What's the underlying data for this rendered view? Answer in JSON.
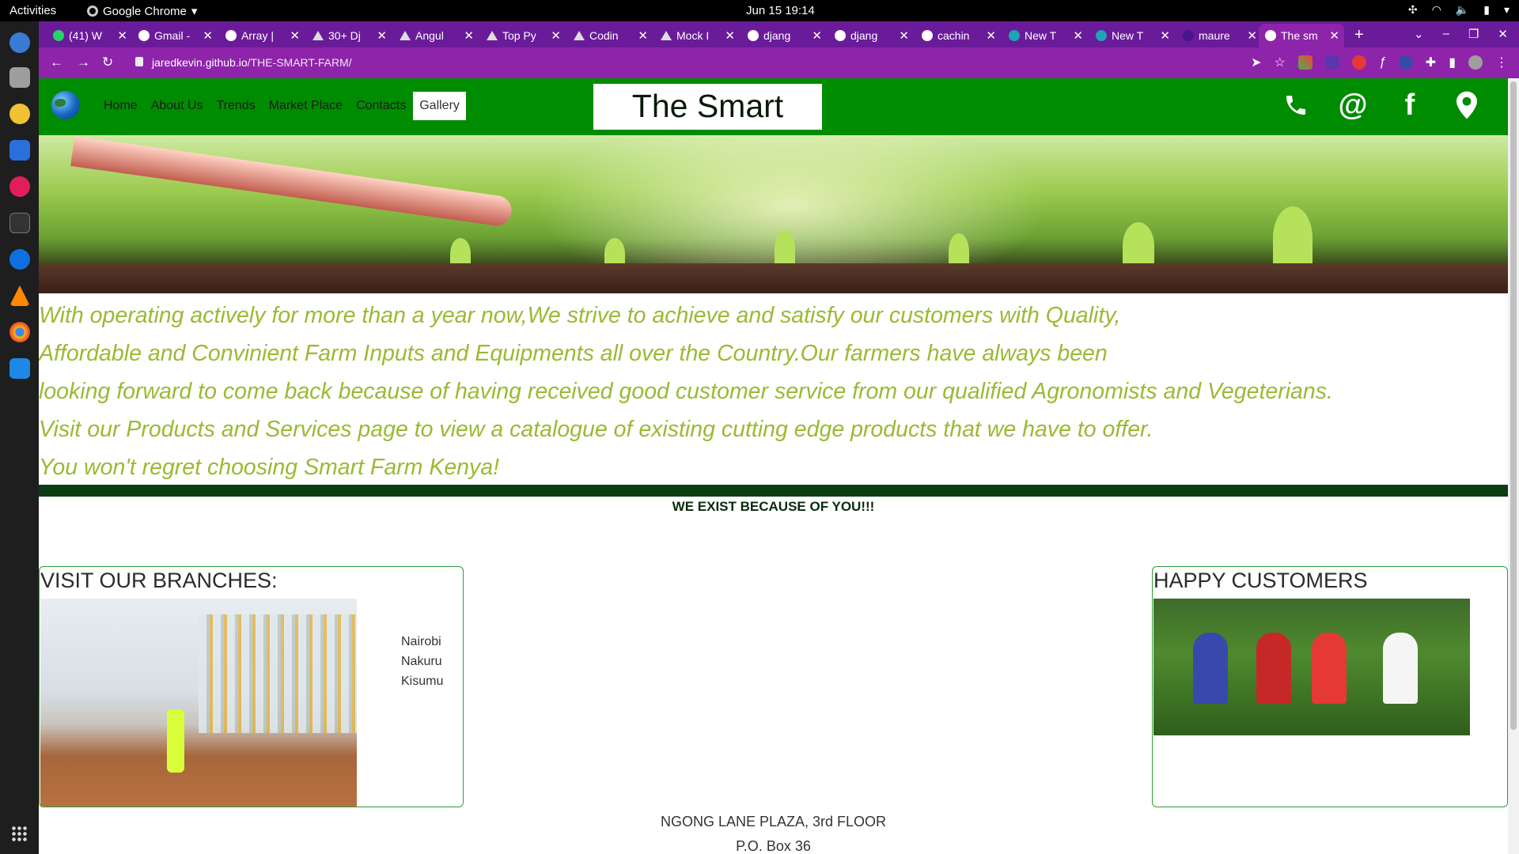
{
  "system": {
    "activities": "Activities",
    "app_name": "Google Chrome",
    "clock": "Jun 15  19:14"
  },
  "browser": {
    "tabs": [
      {
        "label": "(41) W",
        "icon": "whatsapp-icon"
      },
      {
        "label": "Gmail -",
        "icon": "google-icon"
      },
      {
        "label": "Array |",
        "icon": "google-icon"
      },
      {
        "label": "30+ Dj",
        "icon": "mountain-icon"
      },
      {
        "label": "Angul",
        "icon": "mountain-icon"
      },
      {
        "label": "Top Py",
        "icon": "mountain-icon"
      },
      {
        "label": "Codin",
        "icon": "mountain-icon"
      },
      {
        "label": "Mock I",
        "icon": "mountain-icon"
      },
      {
        "label": "djang",
        "icon": "google-icon"
      },
      {
        "label": "djang",
        "icon": "google-icon"
      },
      {
        "label": "cachin",
        "icon": "google-icon"
      },
      {
        "label": "New T",
        "icon": "m-icon"
      },
      {
        "label": "New T",
        "icon": "m-icon"
      },
      {
        "label": "maure",
        "icon": "blank-icon"
      },
      {
        "label": "The sm",
        "icon": "google-icon",
        "active": true
      }
    ],
    "url_host": "jaredkevin.github.io",
    "url_path": "/THE-SMART-FARM/"
  },
  "site": {
    "nav": [
      "Home",
      "About Us",
      "Trends",
      "Market Place",
      "Contacts",
      "Gallery"
    ],
    "nav_active": "Gallery",
    "title": "The Smart Farm",
    "social_icons": [
      "phone-icon",
      "at-icon",
      "facebook-icon",
      "location-pin-icon"
    ],
    "intro_lines": [
      "With operating actively for more than a year now,We strive to achieve and satisfy our customers with Quality,",
      "Affordable and Convinient Farm Inputs and Equipments all over the Country.Our farmers have always been",
      "looking forward to come back because of having received good customer service from our qualified Agronomists and Vegeterians.",
      "Visit our Products and Services page to view a catalogue of existing cutting edge products that we have to offer.",
      "You won't regret choosing Smart Farm Kenya!"
    ],
    "tagline": "WE EXIST BECAUSE OF YOU!!!",
    "branches_title": "VISIT OUR BRANCHES:",
    "branches": [
      "Nairobi",
      "Nakuru",
      "Kisumu"
    ],
    "customers_title": "HAPPY CUSTOMERS",
    "address_line1": "NGONG LANE PLAZA, 3rd FLOOR",
    "address_line2": "P.O. Box 36"
  },
  "colors": {
    "chrome_frame": "#6a1b9a",
    "header_green": "#008c00",
    "intro_text": "#9aba33",
    "divider": "#0a3d14"
  }
}
